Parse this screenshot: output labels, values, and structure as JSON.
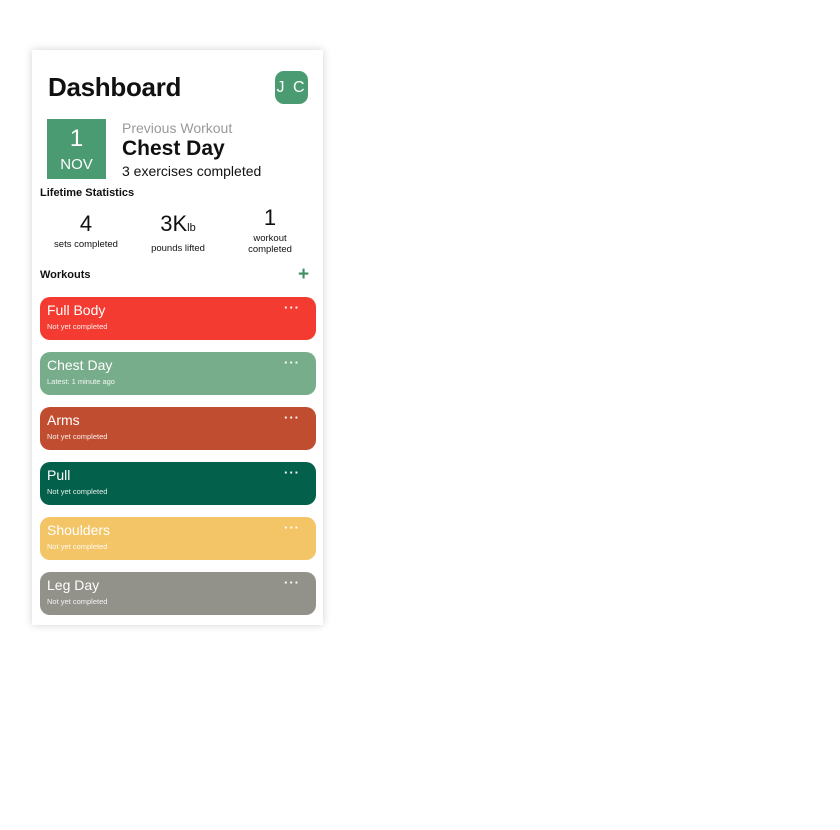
{
  "header": {
    "title": "Dashboard",
    "avatar_initials": "J C"
  },
  "previous_workout": {
    "day": "1",
    "month": "NOV",
    "label": "Previous Workout",
    "name": "Chest Day",
    "subtitle": "3 exercises completed"
  },
  "stats": {
    "heading": "Lifetime Statistics",
    "items": [
      {
        "value": "4",
        "unit": "",
        "label": "sets completed"
      },
      {
        "value": "3K",
        "unit": "lb",
        "label": "pounds lifted"
      },
      {
        "value": "1",
        "unit": "",
        "label": "workout completed"
      }
    ]
  },
  "workouts": {
    "heading": "Workouts",
    "add_icon": "+",
    "more_icon": "···",
    "items": [
      {
        "name": "Full Body",
        "status": "Not yet completed",
        "color": "#f33b32"
      },
      {
        "name": "Chest Day",
        "status": "Latest: 1 minute ago",
        "color": "#78ad8c"
      },
      {
        "name": "Arms",
        "status": "Not yet completed",
        "color": "#c14d30"
      },
      {
        "name": "Pull",
        "status": "Not yet completed",
        "color": "#03604a"
      },
      {
        "name": "Shoulders",
        "status": "Not yet completed",
        "color": "#f3c567"
      },
      {
        "name": "Leg Day",
        "status": "Not yet completed",
        "color": "#92918a"
      }
    ]
  },
  "colors": {
    "accent": "#4b9b72",
    "plus": "#3e8f63"
  }
}
